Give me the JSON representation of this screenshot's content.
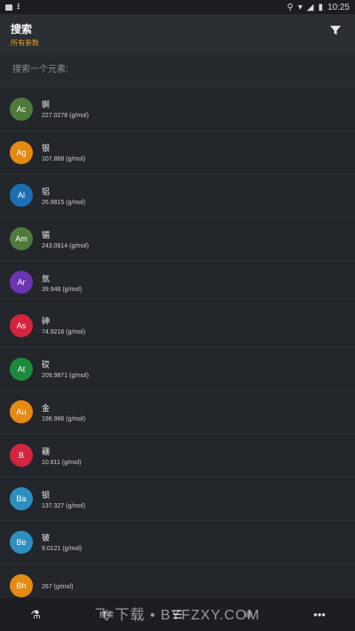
{
  "status_bar": {
    "time": "10:25"
  },
  "app_bar": {
    "title": "搜索",
    "subtitle": "所有参数"
  },
  "search": {
    "placeholder": "搜索一个元素:"
  },
  "elements": [
    {
      "symbol": "Ac",
      "name": "锕",
      "mass": "227.0278 (g/mol)",
      "color": "#4e7a3a"
    },
    {
      "symbol": "Ag",
      "name": "银",
      "mass": "107.868 (g/mol)",
      "color": "#e58a12"
    },
    {
      "symbol": "Al",
      "name": "铝",
      "mass": "26.9815 (g/mol)",
      "color": "#1d6fb3"
    },
    {
      "symbol": "Am",
      "name": "镅",
      "mass": "243.0614 (g/mol)",
      "color": "#4e7a3a"
    },
    {
      "symbol": "Ar",
      "name": "氩",
      "mass": "39.948 (g/mol)",
      "color": "#6b34b0"
    },
    {
      "symbol": "As",
      "name": "砷",
      "mass": "74.9216 (g/mol)",
      "color": "#d4243f"
    },
    {
      "symbol": "At",
      "name": "砹",
      "mass": "209.9871 (g/mol)",
      "color": "#1b8a3a"
    },
    {
      "symbol": "Au",
      "name": "金",
      "mass": "196.966 (g/mol)",
      "color": "#e58a12"
    },
    {
      "symbol": "B",
      "name": "硼",
      "mass": "10.811 (g/mol)",
      "color": "#d4243f"
    },
    {
      "symbol": "Ba",
      "name": "钡",
      "mass": "137.327 (g/mol)",
      "color": "#2d8fbf"
    },
    {
      "symbol": "Be",
      "name": "铍",
      "mass": "9.0121 (g/mol)",
      "color": "#2d8fbf"
    },
    {
      "symbol": "Bh",
      "name": "",
      "mass": "267 (g/mol)",
      "color": "#e58a12"
    }
  ],
  "bottom_nav": {
    "items": [
      {
        "icon": "flask-icon",
        "glyph": "⚗",
        "label": ""
      },
      {
        "icon": "search-icon",
        "glyph": "",
        "label": "搜索"
      },
      {
        "icon": "list-icon",
        "glyph": "☰",
        "label": ""
      },
      {
        "icon": "atom-icon",
        "glyph": "⚛",
        "label": ""
      },
      {
        "icon": "more-icon",
        "glyph": "•••",
        "label": ""
      }
    ]
  },
  "watermark": "飞 下载 • BYFZXY.COM"
}
